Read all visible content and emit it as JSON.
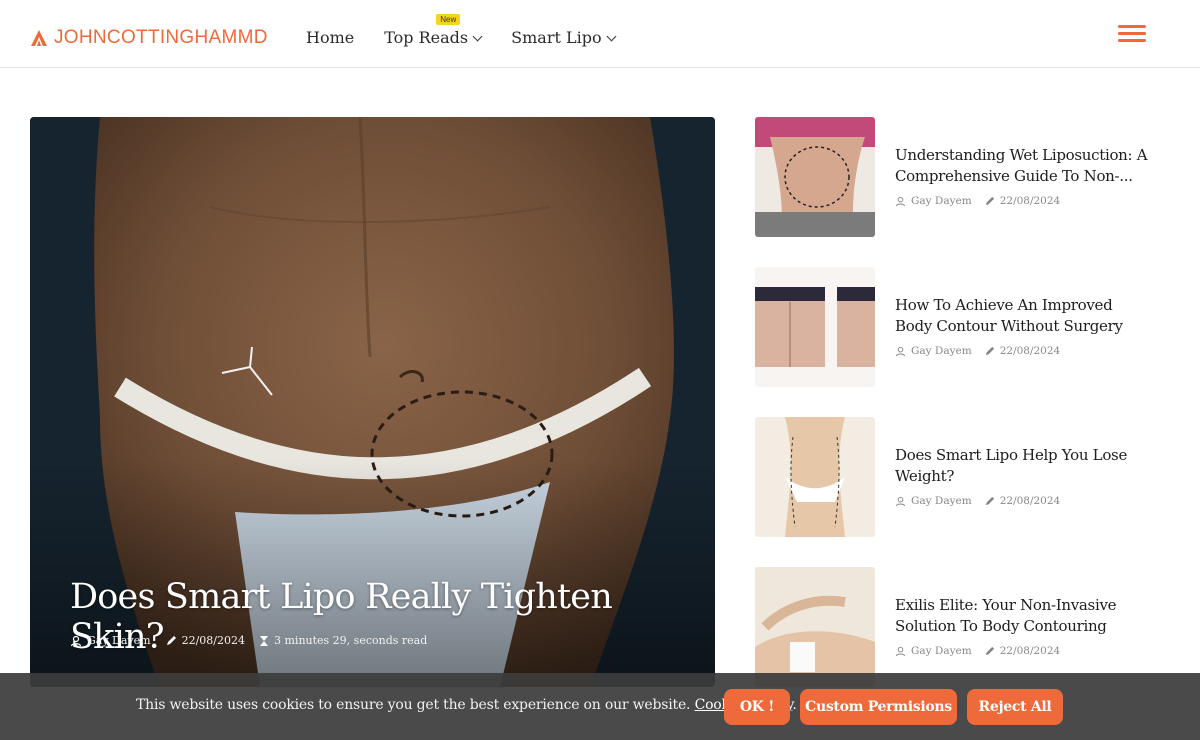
{
  "header": {
    "logo_text": "JOHNCOTTINGHAMMD",
    "nav": [
      {
        "label": "Home"
      },
      {
        "label": "Top Reads",
        "badge": "New"
      },
      {
        "label": "Smart Lipo"
      }
    ]
  },
  "featured": {
    "title": "Does Smart Lipo Really Tighten Skin?",
    "author": "Gay Dayem",
    "date": "22/08/2024",
    "read_time": "3 minutes 29, seconds read"
  },
  "sidebar_posts": [
    {
      "title": "Understanding Wet Liposuction: A Comprehensive Guide To Non-...",
      "author": "Gay Dayem",
      "date": "22/08/2024"
    },
    {
      "title": "How To Achieve An Improved Body Contour Without Surgery",
      "author": "Gay Dayem",
      "date": "22/08/2024"
    },
    {
      "title": "Does Smart Lipo Help You Lose Weight?",
      "author": "Gay Dayem",
      "date": "22/08/2024"
    },
    {
      "title": "Exilis Elite: Your Non-Invasive Solution To Body Contouring",
      "author": "Gay Dayem",
      "date": "22/08/2024"
    }
  ],
  "cookie_bar": {
    "text": "This website uses cookies to ensure you get the best experience on our website.",
    "link": "Cookies Policy",
    "ok": "OK !",
    "custom": "Custom Permisions",
    "reject": "Reject All"
  },
  "colors": {
    "accent": "#ef6a3a",
    "badge": "#f7d51c",
    "cookie_bg": "#3c3c3c"
  },
  "icons": {
    "logo": "triangle-logo-icon",
    "menu": "hamburger-icon",
    "author": "user-icon",
    "date": "pencil-icon",
    "time": "hourglass-icon"
  }
}
